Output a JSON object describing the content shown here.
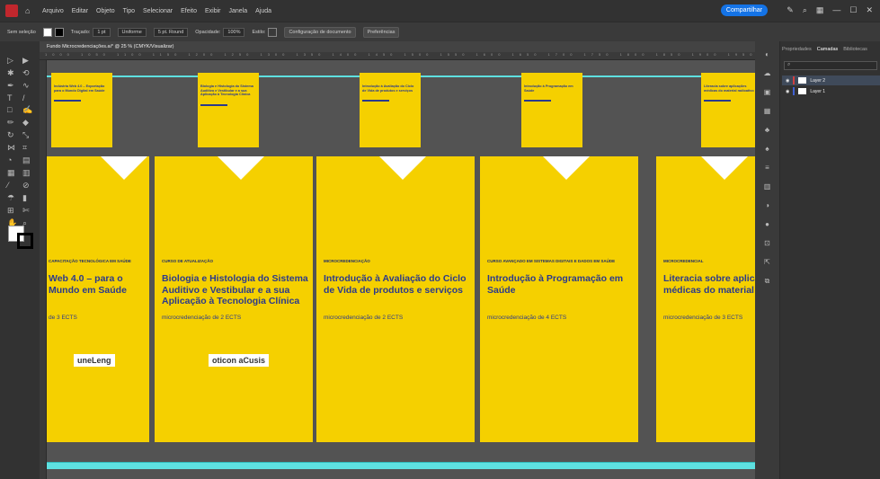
{
  "menubar": {
    "items": [
      "Arquivo",
      "Editar",
      "Objeto",
      "Tipo",
      "Selecionar",
      "Efeito",
      "Exibir",
      "Janela",
      "Ajuda"
    ],
    "share_label": "Compartilhar"
  },
  "controlbar": {
    "selection": "Sem seleção",
    "stroke_label": "Traçado:",
    "stroke_value": "1 pt",
    "profile": "Uniforme",
    "brush": "5 pt. Round",
    "opacity_label": "Opacidade:",
    "opacity_value": "100%",
    "style_label": "Estilo:",
    "doc_setup": "Configuração de documento",
    "prefs": "Preferências"
  },
  "document": {
    "tab_title": "Fundo Microcredenciações.ai* @ 25 % (CMYK/Visualizar)",
    "ruler": "1000 1050 1100 1150 1200 1250 1300 1350 1400 1450 1500 1550 1600 1650 1700 1750 1800 1850 1900 1950 2000 2050 2100"
  },
  "small_cards": [
    {
      "title": "Indústria Web 4.0 – Exportação para o Mundo Digital em Saúde"
    },
    {
      "title": "Biologia e Histologia do Sistema Auditivo e Vestibular e a sua Aplicação à Tecnologia Clínica"
    },
    {
      "title": "Introdução à Avaliação do Ciclo de Vida de produtos e serviços"
    },
    {
      "title": "Introdução à Programação em Saúde"
    },
    {
      "title": "Literacia sobre aplicações médicas do material radioativo"
    }
  ],
  "posters": [
    {
      "category": "CAPACITAÇÃO TECNOLÓGICA EM SAÚDE",
      "title": "Web 4.0 – para o Mundo em Saúde",
      "ects": "de 3 ECTS",
      "partner": "uneLeng"
    },
    {
      "category": "CURSO DE ATUALIZAÇÃO",
      "title": "Biologia e Histologia do Sistema Auditivo e Vestibular e a sua Aplicação à Tecnologia Clínica",
      "ects": "microcredenciação de 2 ECTS",
      "partner": "oticon aCusis"
    },
    {
      "category": "MICROCREDENCIAÇÃO",
      "title": "Introdução à Avaliação do Ciclo de Vida de produtos e serviços",
      "ects": "microcredenciação de 2 ECTS",
      "partner": ""
    },
    {
      "category": "CURSO AVANÇADO EM SISTEMAS DIGITAIS E DADOS EM SAÚDE",
      "title": "Introdução à Programação em Saúde",
      "ects": "microcredenciação de 4 ECTS",
      "partner": ""
    },
    {
      "category": "MICROCREDENCIAL",
      "title": "Literacia sobre aplicações médicas do material ra",
      "ects": "microcredenciação de 3 ECTS",
      "partner": ""
    }
  ],
  "panel": {
    "tabs": [
      "Propriedades",
      "Camadas",
      "Bibliotecas"
    ],
    "layers": [
      "Layer 2",
      "Layer 1"
    ]
  },
  "colors": {
    "accent": "#1473e6",
    "poster_yellow": "#f5d000",
    "guide": "#5ee0e0",
    "layer2": "#d04040",
    "layer1": "#4060d0"
  }
}
